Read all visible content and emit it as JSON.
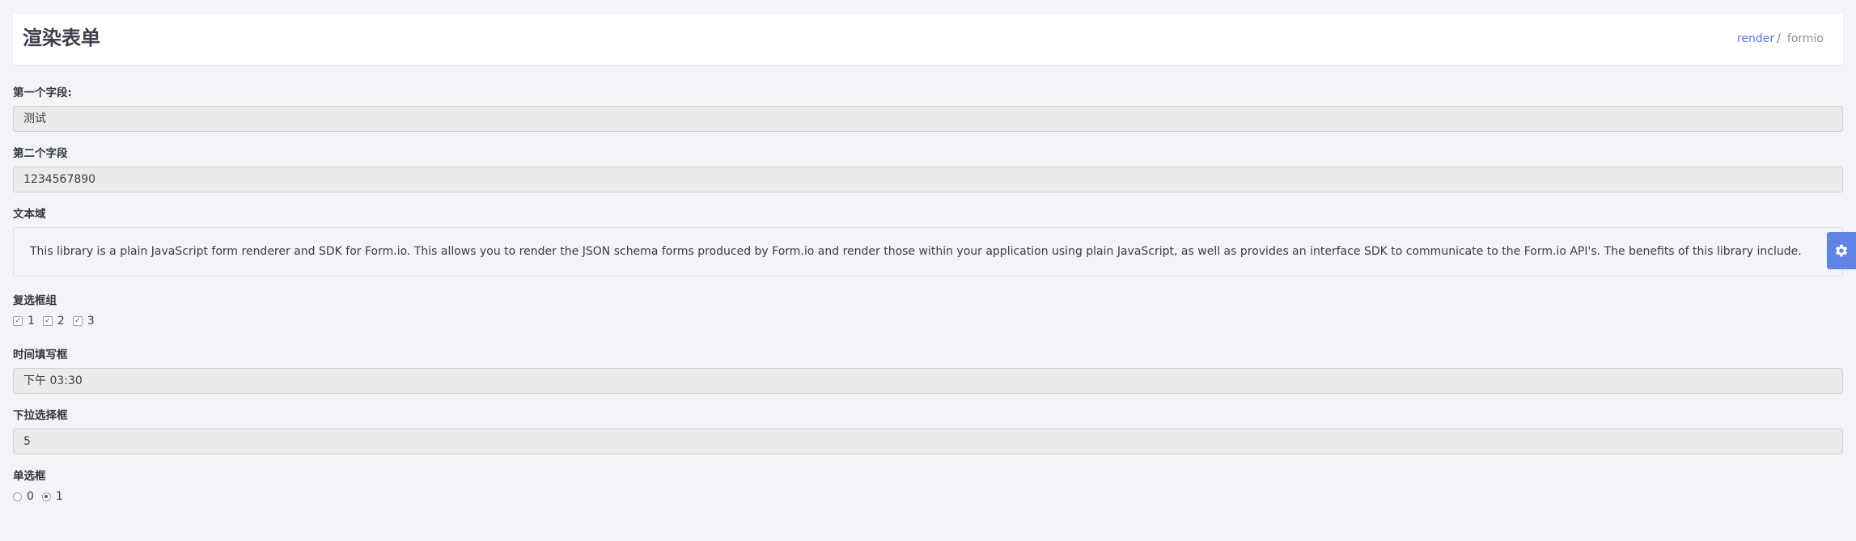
{
  "header": {
    "title": "渲染表单",
    "breadcrumb": {
      "link": "render",
      "separator": "/",
      "current": "formio"
    }
  },
  "form": {
    "field1": {
      "label": "第一个字段:",
      "value": "测试"
    },
    "field2": {
      "label": "第二个字段",
      "value": "1234567890"
    },
    "textarea": {
      "label": "文本域",
      "value": "This library is a plain JavaScript form renderer and SDK for Form.io. This allows you to render the JSON schema forms produced by Form.io and render those within your application using plain JavaScript, as well as provides an interface SDK to communicate to the Form.io API's. The benefits of this library include."
    },
    "checkbox_group": {
      "label": "复选框组",
      "options": [
        {
          "label": "1",
          "checked": true
        },
        {
          "label": "2",
          "checked": true
        },
        {
          "label": "3",
          "checked": true
        }
      ]
    },
    "time": {
      "label": "时间填写框",
      "value": "下午 03:30"
    },
    "select": {
      "label": "下拉选择框",
      "value": "5"
    },
    "radio": {
      "label": "单选框",
      "options": [
        {
          "label": "0",
          "selected": false
        },
        {
          "label": "1",
          "selected": true
        }
      ]
    }
  },
  "settings_button": {
    "icon": "gear-icon",
    "color": "#5f84e6"
  }
}
